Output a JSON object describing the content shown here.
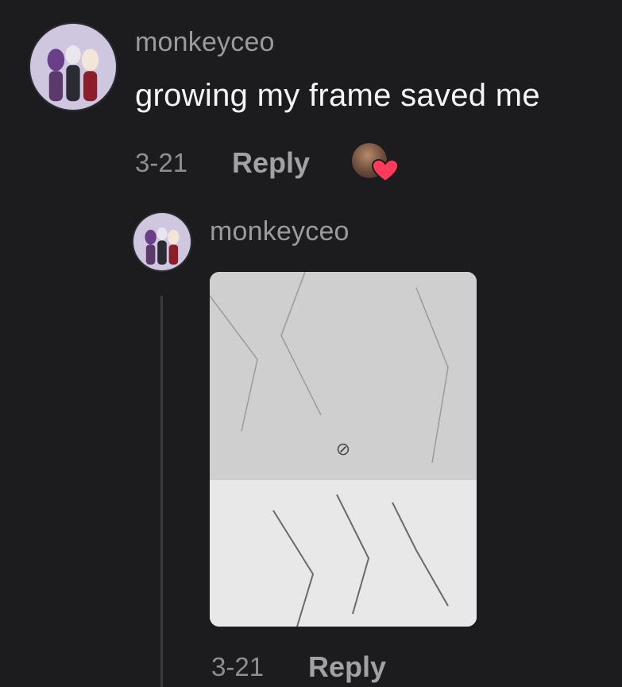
{
  "comment": {
    "username": "monkeyceo",
    "text": "growing my frame saved me",
    "date": "3-21",
    "reply_label": "Reply"
  },
  "reply": {
    "username": "monkeyceo",
    "date": "3-21",
    "reply_label": "Reply"
  },
  "colors": {
    "background": "#1c1c1e",
    "heart": "#ff3b5c"
  }
}
